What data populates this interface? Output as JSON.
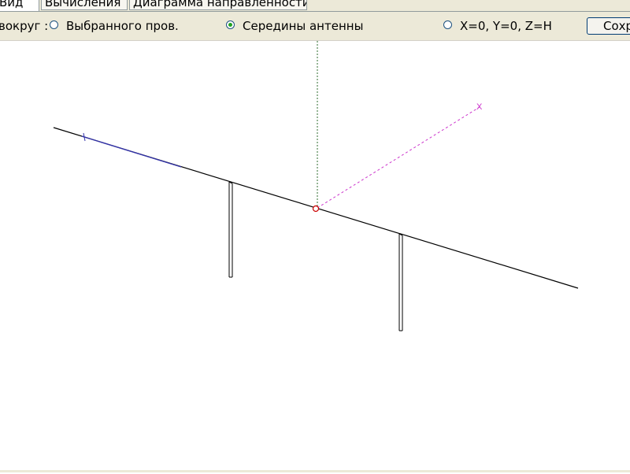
{
  "tabs": [
    {
      "label": "Вид",
      "active": true
    },
    {
      "label": "Вычисления",
      "active": false
    },
    {
      "label": "Диаграмма направленности",
      "active": false
    }
  ],
  "rotation": {
    "label": "вокруг :",
    "options": [
      {
        "label": "Выбранного пров.",
        "selected": false
      },
      {
        "label": "Середины антенны",
        "selected": true
      },
      {
        "label": "X=0, Y=0, Z=H",
        "selected": false
      }
    ]
  },
  "toolbar": {
    "save_label": "Сохр"
  },
  "viewport": {
    "axis_label": "X",
    "colors": {
      "wire": "#000000",
      "axis_x": "#cc33cc",
      "axis_z": "#2e6b2e",
      "center_marker": "#cc0000",
      "wire_end_mark": "#3333aa"
    }
  }
}
